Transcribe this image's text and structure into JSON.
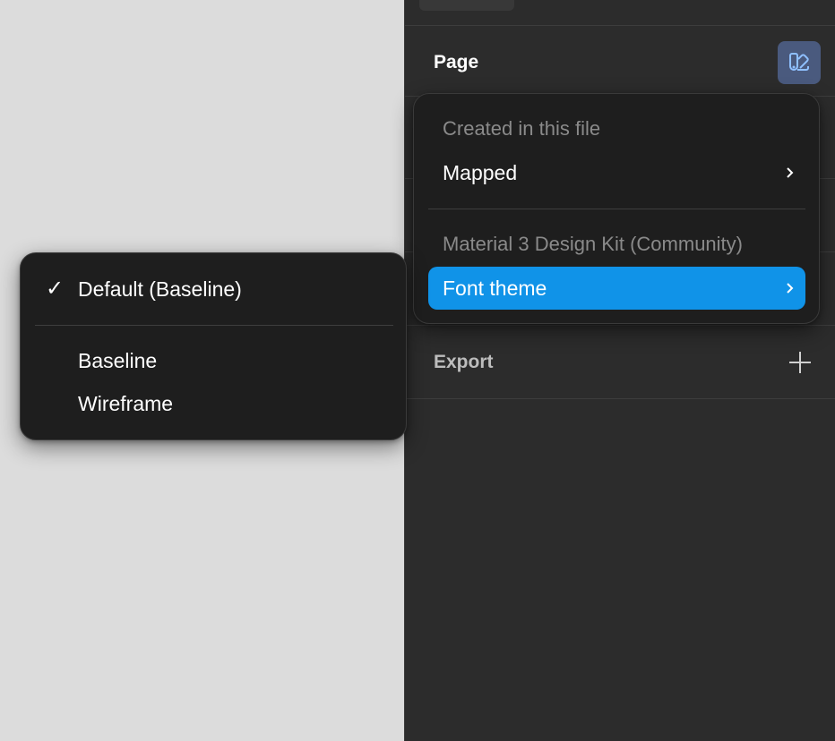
{
  "panel": {
    "page_section": {
      "title": "Page"
    },
    "export_section": {
      "title": "Export"
    }
  },
  "library_menu": {
    "group1_heading": "Created in this file",
    "group1_items": [
      {
        "label": "Mapped",
        "has_submenu": true
      }
    ],
    "group2_heading": "Material 3 Design Kit (Community)",
    "group2_items": [
      {
        "label": "Font theme",
        "has_submenu": true,
        "highlighted": true
      }
    ]
  },
  "theme_submenu": {
    "selected": {
      "label": "Default (Baseline)",
      "check": "✓"
    },
    "options": [
      {
        "label": "Baseline"
      },
      {
        "label": "Wireframe"
      }
    ]
  },
  "colors": {
    "accent": "#1093e8",
    "panel_bg": "#2c2c2c",
    "menu_bg": "#1e1e1e",
    "canvas_bg": "#dcdcdc",
    "library_button": "#4a5a7e"
  },
  "icons": {
    "library_button": "library-swap-icon",
    "submenu_arrow": "chevron-right-icon",
    "add": "plus-icon",
    "selected": "checkmark-icon"
  }
}
